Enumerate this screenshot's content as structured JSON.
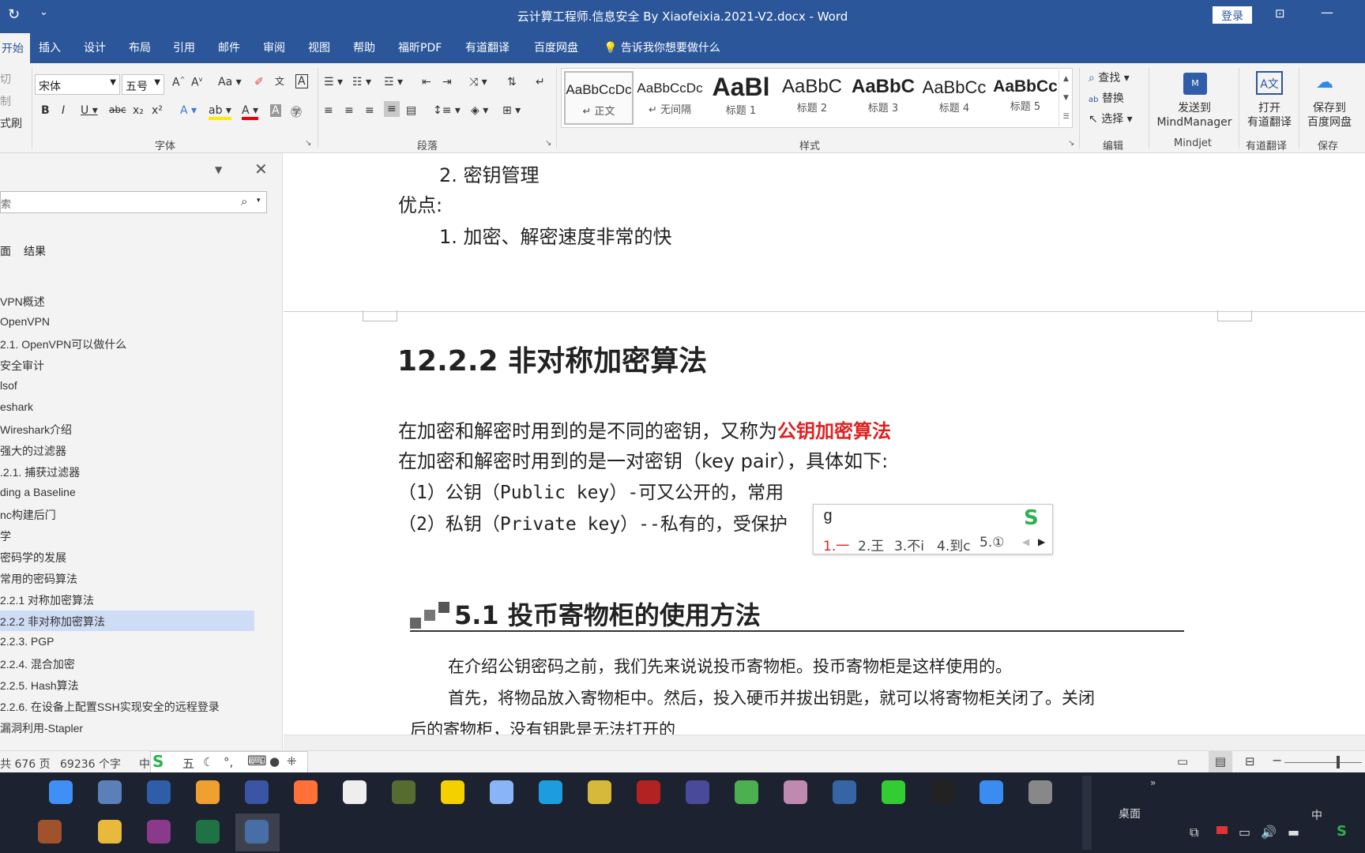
{
  "window": {
    "title": "云计算工程师.信息安全 By Xiaofeixia.2021-V2.docx  -  Word",
    "login": "登录"
  },
  "menu": {
    "tabs": [
      "开始",
      "插入",
      "设计",
      "布局",
      "引用",
      "邮件",
      "审阅",
      "视图",
      "帮助",
      "福昕PDF",
      "有道翻译",
      "百度网盘"
    ],
    "tell_me": "告诉我你想要做什么"
  },
  "ribbon": {
    "clipboard": [
      "切",
      "制",
      "式刷"
    ],
    "font": {
      "name": "宋体",
      "size": "五号",
      "label": "字体"
    },
    "paragraph_label": "段落",
    "styles": [
      {
        "sample": "AaBbCcDc",
        "name": "↵ 正文"
      },
      {
        "sample": "AaBbCcDc",
        "name": "↵ 无间隔"
      },
      {
        "sample": "AaBl",
        "name": "标题 1"
      },
      {
        "sample": "AaBbC",
        "name": "标题 2"
      },
      {
        "sample": "AaBbC",
        "name": "标题 3"
      },
      {
        "sample": "AaBbCc",
        "name": "标题 4"
      },
      {
        "sample": "AaBbCc",
        "name": "标题 5"
      }
    ],
    "styles_label": "样式",
    "editing": {
      "find": "查找",
      "replace": "替换",
      "select": "选择",
      "label": "编辑"
    },
    "mindmanager": {
      "line1": "发送到",
      "line2": "MindManager",
      "label": "Mindjet"
    },
    "youdao": {
      "line1": "打开",
      "line2": "有道翻译",
      "label": "有道翻译"
    },
    "baidu": {
      "line1": "保存到",
      "line2": "百度网盘",
      "label": "保存"
    }
  },
  "nav": {
    "search_placeholder": "索",
    "tabs": [
      "面",
      "结果"
    ],
    "items": [
      "VPN概述",
      "OpenVPN",
      "2.1. OpenVPN可以做什么",
      "安全审计",
      "lsof",
      "eshark",
      "Wireshark介绍",
      "强大的过滤器",
      ".2.1. 捕获过滤器",
      "ding a Baseline",
      "nc构建后门",
      "学",
      "密码学的发展",
      "常用的密码算法",
      "2.2.1 对称加密算法",
      "2.2.2 非对称加密算法",
      "2.2.3. PGP",
      "2.2.4. 混合加密",
      "2.2.5. Hash算法",
      "2.2.6. 在设备上配置SSH实现安全的远程登录",
      "漏洞利用-Stapler"
    ],
    "selected_index": 15
  },
  "doc": {
    "list_item_2": "2.  密钥管理",
    "advantages": "优点:",
    "adv_item_1": "1.  加密、解密速度非常的快",
    "heading": "12.2.2  非对称加密算法",
    "p1_a": "在加密和解密时用到的是不同的密钥，又称为",
    "p1_b": "公钥加密算法",
    "p2": "在加密和解密时用到的是一对密钥（key pair），具体如下:",
    "p3": "（1）公钥（Public key）-可又公开的，常用",
    "p4": "（2）私钥（Private key）--私有的，受保护",
    "img_heading": "5.1   投币寄物柜的使用方法",
    "img_p1": "在介绍公钥密码之前，我们先来说说投币寄物柜。投币寄物柜是这样使用的。",
    "img_p2": "首先，将物品放入寄物柜中。然后，投入硬币并拔出钥匙，就可以将寄物柜关闭了。关闭",
    "img_p3": "后的寄物柜，没有钥匙是无法打开的"
  },
  "ime": {
    "input": "g",
    "candidates": [
      "1.一",
      "2.王",
      "3.不i",
      "4.到c",
      "5.①"
    ]
  },
  "status": {
    "pages": "共 676 页",
    "words": "69236 个字",
    "lang": "中"
  },
  "ime_bar": [
    "五",
    "☾",
    "°,",
    "⌨"
  ],
  "taskbar": {
    "desktop": "桌面",
    "ime": "中"
  },
  "colors": {
    "brand": "#2b579a",
    "red_text": "#e02020",
    "nav_selected": "#cfdcf5"
  }
}
